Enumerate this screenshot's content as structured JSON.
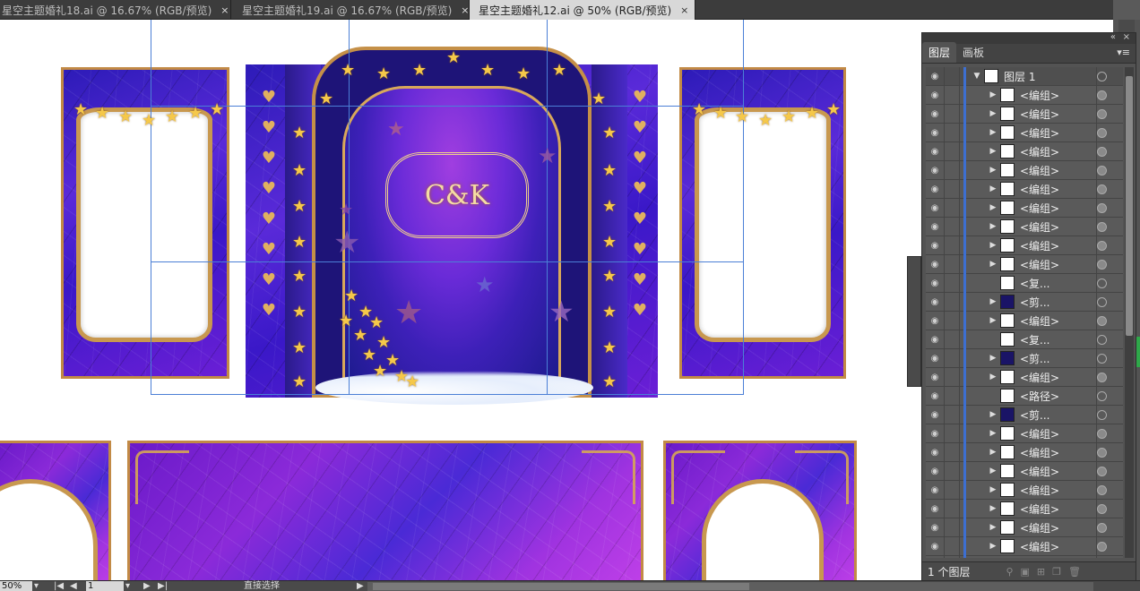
{
  "tabs": [
    {
      "label": "星空主题婚礼18.ai @ 16.67% (RGB/预览)",
      "close": "×"
    },
    {
      "label": "星空主题婚礼19.ai @ 16.67% (RGB/预览)",
      "close": "×"
    },
    {
      "label": "星空主题婚礼12.ai @ 50% (RGB/预览)",
      "close": "×"
    }
  ],
  "artwork": {
    "monogram": "C&K"
  },
  "layers_panel": {
    "tabs": [
      "图层",
      "画板"
    ],
    "top_layer": "图层 1",
    "rows": [
      {
        "name": "<编组>",
        "thumb": "light",
        "expand": true,
        "circle": "full"
      },
      {
        "name": "<编组>",
        "thumb": "light",
        "expand": true,
        "circle": "full"
      },
      {
        "name": "<编组>",
        "thumb": "light",
        "expand": true,
        "circle": "full"
      },
      {
        "name": "<编组>",
        "thumb": "light",
        "expand": true,
        "circle": "full"
      },
      {
        "name": "<编组>",
        "thumb": "light",
        "expand": true,
        "circle": "full"
      },
      {
        "name": "<编组>",
        "thumb": "light",
        "expand": true,
        "circle": "full"
      },
      {
        "name": "<编组>",
        "thumb": "light",
        "expand": true,
        "circle": "full"
      },
      {
        "name": "<编组>",
        "thumb": "light",
        "expand": true,
        "circle": "full"
      },
      {
        "name": "<编组>",
        "thumb": "light",
        "expand": true,
        "circle": "full"
      },
      {
        "name": "<编组>",
        "thumb": "light",
        "expand": true,
        "circle": "full"
      },
      {
        "name": "<复...",
        "thumb": "light",
        "expand": false,
        "circle": "empty"
      },
      {
        "name": "<剪...",
        "thumb": "dark",
        "expand": true,
        "circle": "empty"
      },
      {
        "name": "<编组>",
        "thumb": "light",
        "expand": true,
        "circle": "full"
      },
      {
        "name": "<复...",
        "thumb": "light",
        "expand": false,
        "circle": "empty"
      },
      {
        "name": "<剪...",
        "thumb": "dark",
        "expand": true,
        "circle": "empty"
      },
      {
        "name": "<编组>",
        "thumb": "light",
        "expand": true,
        "circle": "full"
      },
      {
        "name": "<路径>",
        "thumb": "light",
        "expand": false,
        "circle": "empty"
      },
      {
        "name": "<剪...",
        "thumb": "dark",
        "expand": true,
        "circle": "empty"
      },
      {
        "name": "<编组>",
        "thumb": "light",
        "expand": true,
        "circle": "full"
      },
      {
        "name": "<编组>",
        "thumb": "light",
        "expand": true,
        "circle": "full"
      },
      {
        "name": "<编组>",
        "thumb": "light",
        "expand": true,
        "circle": "full"
      },
      {
        "name": "<编组>",
        "thumb": "light",
        "expand": true,
        "circle": "full"
      },
      {
        "name": "<编组>",
        "thumb": "light",
        "expand": true,
        "circle": "full"
      },
      {
        "name": "<编组>",
        "thumb": "light",
        "expand": true,
        "circle": "full"
      },
      {
        "name": "<编组>",
        "thumb": "light",
        "expand": true,
        "circle": "full"
      },
      {
        "name": "<编组>",
        "thumb": "light",
        "expand": true,
        "circle": "full"
      }
    ],
    "footer_count": "1 个图层"
  },
  "status_bar": {
    "zoom": "50%",
    "artboard": "1",
    "tool": "直接选择"
  },
  "colors": {
    "accent_gold": "#c8984f",
    "layer_bar": "#3d6fd1"
  }
}
